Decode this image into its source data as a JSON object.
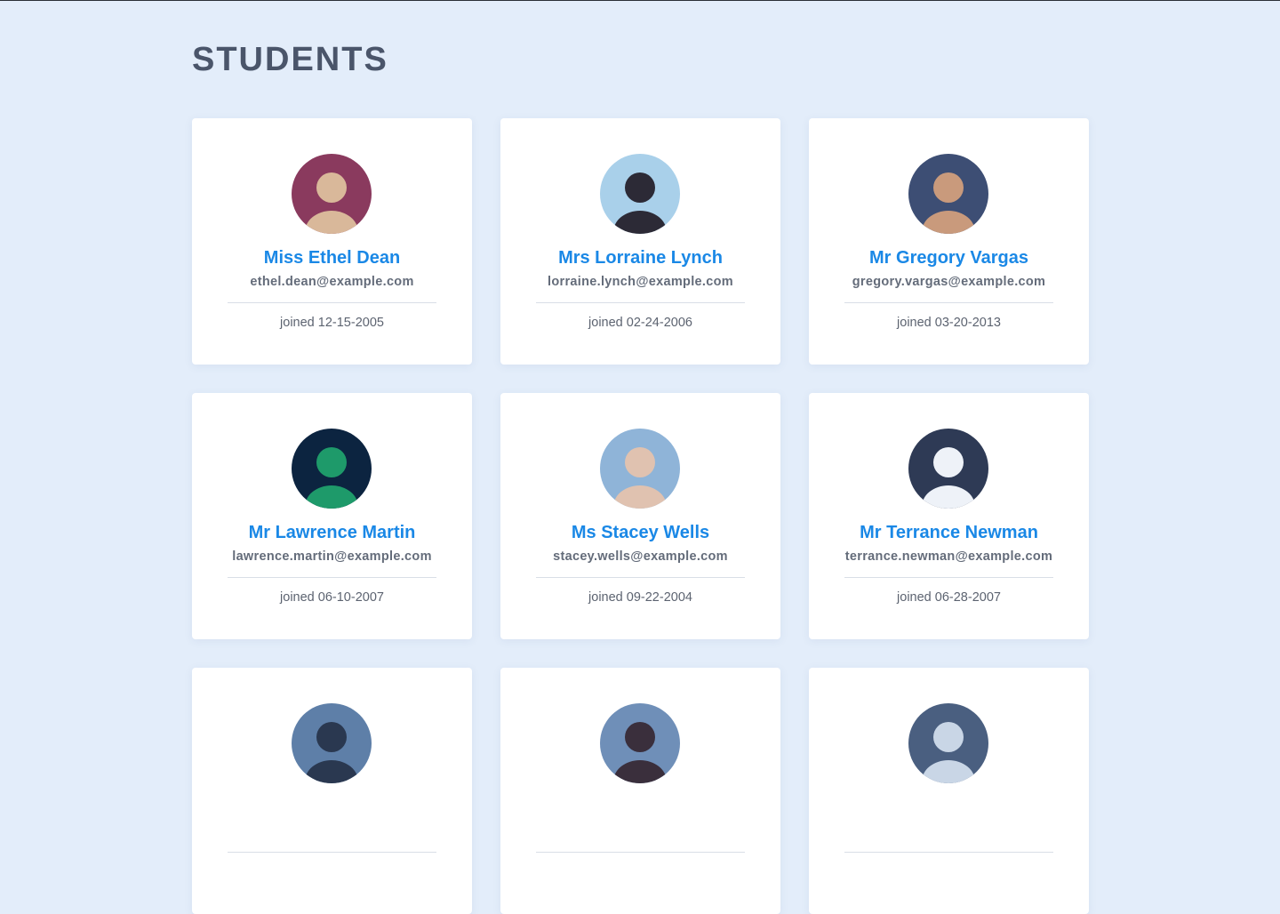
{
  "page": {
    "title": "STUDENTS"
  },
  "students": [
    {
      "name": "Miss Ethel Dean",
      "email": "ethel.dean@example.com",
      "joined": "joined 12-15-2005",
      "avatar_bg": "#8a3a5e",
      "avatar_fg": "#d9b89a"
    },
    {
      "name": "Mrs Lorraine Lynch",
      "email": "lorraine.lynch@example.com",
      "joined": "joined 02-24-2006",
      "avatar_bg": "#a9d0ea",
      "avatar_fg": "#2c2a36"
    },
    {
      "name": "Mr Gregory Vargas",
      "email": "gregory.vargas@example.com",
      "joined": "joined 03-20-2013",
      "avatar_bg": "#3d4e74",
      "avatar_fg": "#c99a7c"
    },
    {
      "name": "Mr Lawrence Martin",
      "email": "lawrence.martin@example.com",
      "joined": "joined 06-10-2007",
      "avatar_bg": "#0c2440",
      "avatar_fg": "#1e9a6a"
    },
    {
      "name": "Ms Stacey Wells",
      "email": "stacey.wells@example.com",
      "joined": "joined 09-22-2004",
      "avatar_bg": "#8fb4d8",
      "avatar_fg": "#e0c2b0"
    },
    {
      "name": "Mr Terrance Newman",
      "email": "terrance.newman@example.com",
      "joined": "joined 06-28-2007",
      "avatar_bg": "#2e3a55",
      "avatar_fg": "#eef2f8"
    },
    {
      "name": "",
      "email": "",
      "joined": "",
      "avatar_bg": "#5e7fa8",
      "avatar_fg": "#2a3850"
    },
    {
      "name": "",
      "email": "",
      "joined": "",
      "avatar_bg": "#6f8fb8",
      "avatar_fg": "#3a2f3c"
    },
    {
      "name": "",
      "email": "",
      "joined": "",
      "avatar_bg": "#4a5f80",
      "avatar_fg": "#c9d6e6"
    }
  ]
}
